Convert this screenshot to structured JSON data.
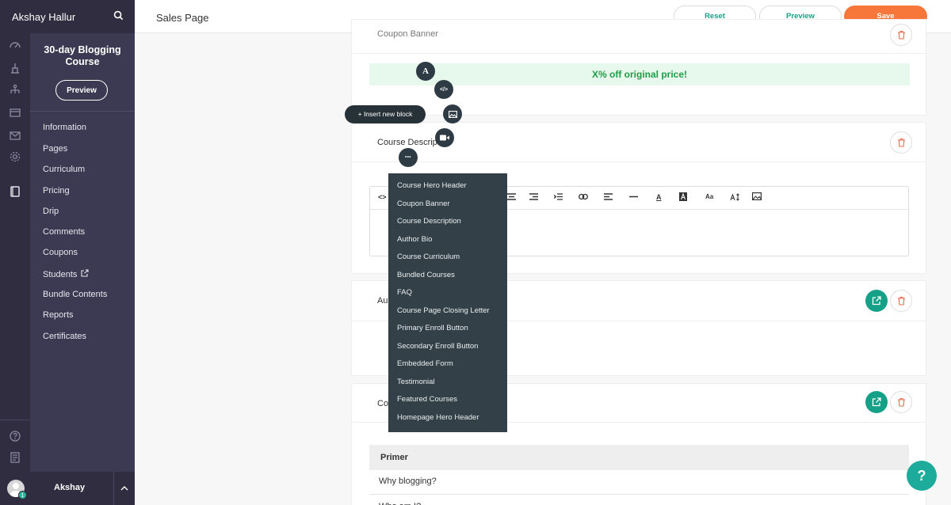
{
  "user": {
    "name": "Akshay Hallur",
    "short_name": "Akshay",
    "badge": "1"
  },
  "header": {
    "title": "Sales Page",
    "reset_label": "Reset",
    "preview_label": "Preview",
    "save_label": "Save"
  },
  "course": {
    "title": "30-day Blogging Course",
    "preview_label": "Preview"
  },
  "nav": {
    "items": [
      "Information",
      "Pages",
      "Curriculum",
      "Pricing",
      "Drip",
      "Comments",
      "Coupons",
      "Students",
      "Bundle Contents",
      "Reports",
      "Certificates"
    ]
  },
  "blocks": {
    "coupon": {
      "title": "Coupon Banner",
      "banner_text": "X% off original price!"
    },
    "description": {
      "title": "Course Description"
    },
    "author": {
      "title": "Au"
    },
    "curriculum": {
      "title": "Co",
      "rows": [
        "Primer",
        "Why blogging?",
        "Who am I?"
      ]
    }
  },
  "floating": {
    "insert_label": "+ Insert new block",
    "font_icon": "A",
    "code_icon": "</>",
    "more_icon": "•••"
  },
  "editor_toolbar": {
    "code": "<>",
    "font_size": "Aa",
    "text_a": "A"
  },
  "block_menu": {
    "items": [
      "Course Hero Header",
      "Coupon Banner",
      "Course Description",
      "Author Bio",
      "Course Curriculum",
      "Bundled Courses",
      "FAQ",
      "Course Page Closing Letter",
      "Primary Enroll Button",
      "Secondary Enroll Button",
      "Embedded Form",
      "Testimonial",
      "Featured Courses",
      "Homepage Hero Header"
    ]
  },
  "help": {
    "label": "?"
  },
  "colors": {
    "sidebar": "#2f2d3f",
    "subnav": "#3b3a52",
    "accent_green": "#15a187",
    "save_orange": "#f7763a",
    "menu_bg": "#334048"
  }
}
